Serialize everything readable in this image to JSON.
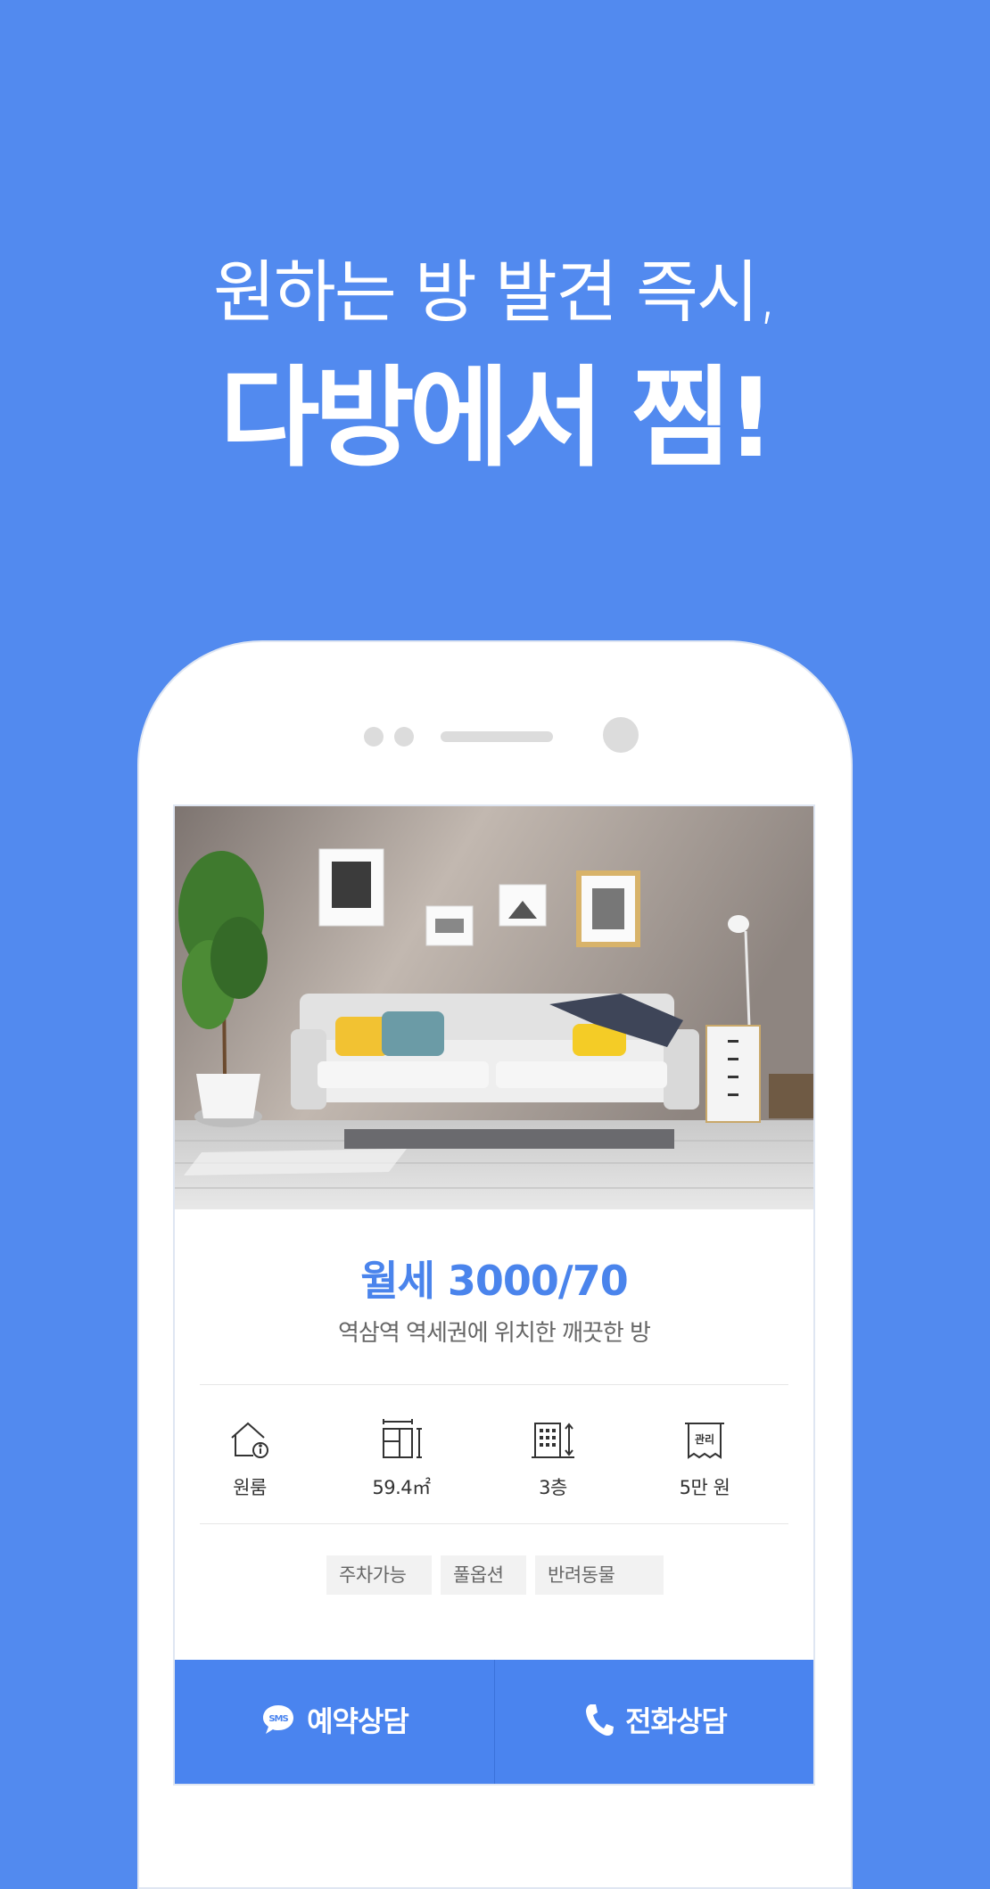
{
  "headline": {
    "line1": "원하는 방 발견 즉시,",
    "line2": "다방에서 찜!"
  },
  "listing": {
    "price": "월세 3000/70",
    "description": "역삼역 역세권에 위치한 깨끗한 방",
    "features": [
      {
        "icon": "house-info-icon",
        "label": "원룸"
      },
      {
        "icon": "floor-area-icon",
        "label": "59.4㎡"
      },
      {
        "icon": "building-floor-icon",
        "label": "3층"
      },
      {
        "icon": "management-fee-icon",
        "label": "5만 원",
        "icon_text": "관리"
      }
    ],
    "tags": [
      "주차가능",
      "풀옵션",
      "반려동물"
    ]
  },
  "actions": {
    "sms": {
      "icon_text": "SMS",
      "label": "예약상담"
    },
    "call": {
      "label": "전화상담"
    }
  },
  "colors": {
    "background": "#528aef",
    "accent": "#4a84ec",
    "button": "#4a84ef"
  }
}
